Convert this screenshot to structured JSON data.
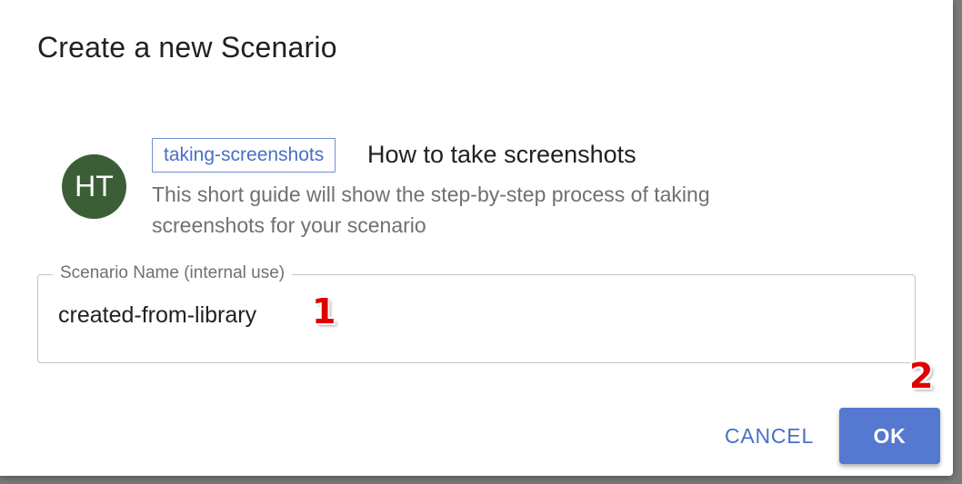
{
  "dialog": {
    "title": "Create a new Scenario"
  },
  "template_item": {
    "avatar_initials": "HT",
    "tag": "taking-screenshots",
    "title": "How to take screenshots",
    "description": "This short guide will show the step-by-step process of taking screenshots for your scenario"
  },
  "scenario_name_field": {
    "label": "Scenario Name (internal use)",
    "value": "created-from-library"
  },
  "annotations": {
    "marker_1": "1",
    "marker_2": "2"
  },
  "actions": {
    "cancel_label": "CANCEL",
    "ok_label": "OK"
  },
  "colors": {
    "accent": "#5578d0",
    "avatar_bg": "#3b5e37",
    "marker": "#e00000"
  }
}
